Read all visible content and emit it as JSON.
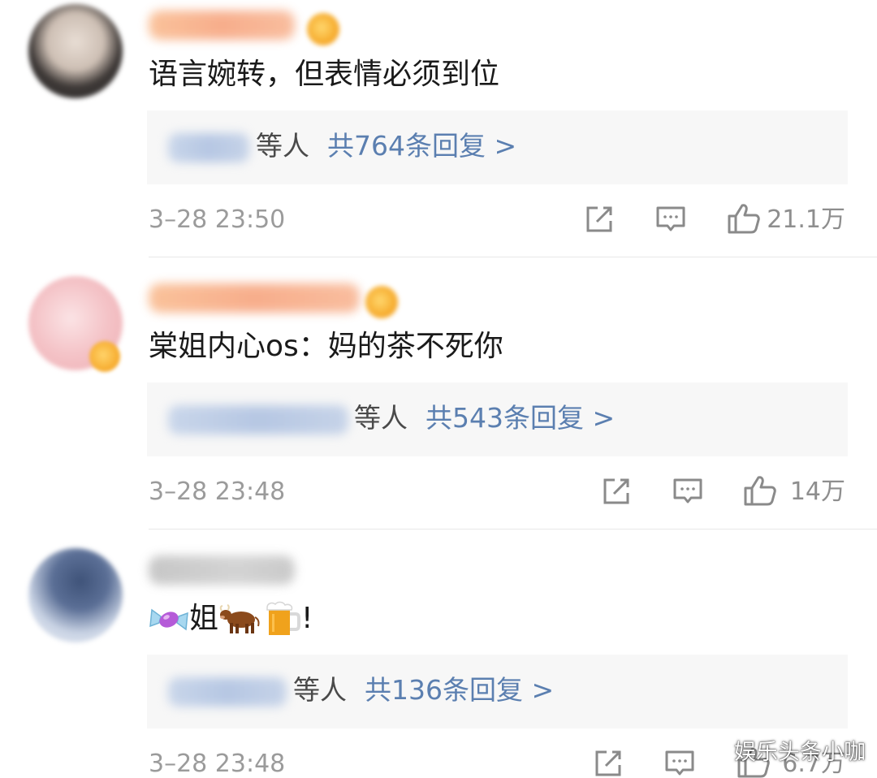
{
  "comments": [
    {
      "text": "语言婉转，但表情必须到位",
      "reply_others": "等人",
      "reply_total": "共764条回复 >",
      "timestamp": "3–28 23:50",
      "like_count": "21.1万",
      "username_style": "vip-orange",
      "avatar_colors": [
        "#3a3a3a",
        "#d9cfc6"
      ]
    },
    {
      "text": "棠姐内心os：妈的茶不死你",
      "reply_others": "等人",
      "reply_total": "共543条回复 >",
      "timestamp": "3–28 23:48",
      "like_count": "14万",
      "username_style": "vip-orange",
      "avatar_colors": [
        "#f4b9bd",
        "#f6d4d6"
      ]
    },
    {
      "text_parts": [
        "姐",
        "!"
      ],
      "emojis": [
        "candy-emoji",
        "ox-emoji",
        "beer-emoji"
      ],
      "reply_others": "等人",
      "reply_total": "共136条回复 >",
      "timestamp": "3–28 23:48",
      "like_count": "6.7万",
      "username_style": "gray",
      "avatar_colors": [
        "#4b5f86",
        "#dfe6f1"
      ]
    }
  ],
  "icons": [
    "share-icon",
    "comment-icon",
    "like-icon"
  ],
  "colors": {
    "reply_link": "#5b7fb0",
    "reply_bg": "#f7f7f7",
    "timestamp": "#9b9b9b",
    "username_vip": "#f6a078"
  },
  "watermark": "娱乐头条小咖"
}
